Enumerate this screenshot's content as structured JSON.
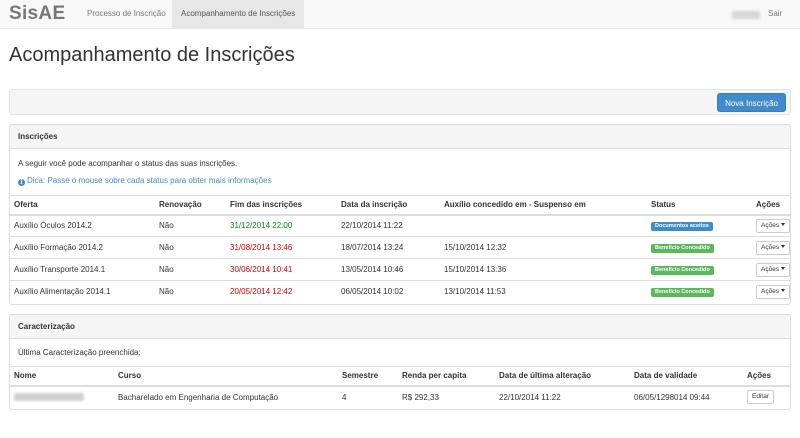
{
  "navbar": {
    "brand": "SisAE",
    "tabs": [
      {
        "label": "Processo de Inscrição",
        "active": false
      },
      {
        "label": "Acompanhamento de Inscrições",
        "active": true
      }
    ],
    "logout_label": "Sair"
  },
  "page": {
    "title": "Acompanhamento de Inscrições",
    "new_button_label": "Nova Inscrição"
  },
  "inscricoes": {
    "heading": "Inscrições",
    "intro": "A seguir você pode acompanhar o status das suas inscrições.",
    "hint": "Dica: Passe o mouse sobre cada status para obter mais informações",
    "columns": [
      "Oferta",
      "Renovação",
      "Fim das inscrições",
      "Data da inscrição",
      "Auxílio concedido em - Suspenso em",
      "Status",
      "Ações"
    ],
    "rows": [
      {
        "oferta": "Auxílio Óculos 2014.2",
        "renovacao": "Não",
        "fim": "31/12/2014 22:00",
        "fim_color": "green",
        "data": "22/10/2014 11:22",
        "concedido": "",
        "status": "Documentos aceitos",
        "status_color": "#428bca",
        "acoes": "Ações"
      },
      {
        "oferta": "Auxílio Formação 2014.2",
        "renovacao": "Não",
        "fim": "31/08/2014 13:46",
        "fim_color": "red",
        "data": "18/07/2014 13:24",
        "concedido": "15/10/2014 12:32",
        "status": "Benefício Concedido",
        "status_color": "#5cb85c",
        "acoes": "Ações"
      },
      {
        "oferta": "Auxílio Transporte 2014.1",
        "renovacao": "Não",
        "fim": "30/06/2014 10:41",
        "fim_color": "red",
        "data": "13/05/2014 10:46",
        "concedido": "15/10/2014 13:36",
        "status": "Benefício Concedido",
        "status_color": "#5cb85c",
        "acoes": "Ações"
      },
      {
        "oferta": "Auxílio Alimentação 2014.1",
        "renovacao": "Não",
        "fim": "20/05/2014 12:42",
        "fim_color": "red",
        "data": "06/05/2014 10:02",
        "concedido": "13/10/2014 11:53",
        "status": "Benefício Concedido",
        "status_color": "#5cb85c",
        "acoes": "Ações"
      }
    ]
  },
  "caracterizacao": {
    "heading": "Caracterização",
    "intro": "Última Caracterização preenchida:",
    "columns": [
      "Nome",
      "Curso",
      "Semestre",
      "Renda per capita",
      "Data de última alteração",
      "Data de validade",
      "Ações"
    ],
    "rows": [
      {
        "curso": "Bacharelado em Engenharia de Computação",
        "semestre": "4",
        "renda": "R$ 292,33",
        "alteracao": "22/10/2014 11:22",
        "validade": "06/05/1298014 09:44",
        "acao": "Editar"
      }
    ]
  }
}
